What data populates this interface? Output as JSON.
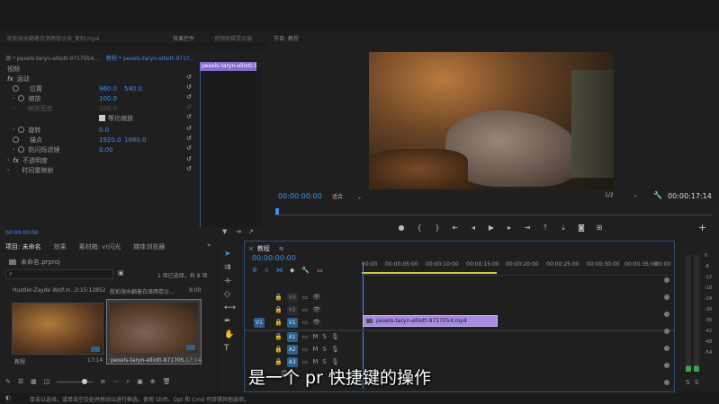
{
  "top_tabs": {
    "source_tab": "航拍海水翻着白浪两卷沙海_复制.mp4",
    "effect_controls_tab": "效果控件",
    "audio_mixer_tab": "音频剪辑混合器",
    "program_tab": "节目: 教程"
  },
  "effect_controls": {
    "source_label": "源 * pexels-taryn-elliott-9717054...",
    "sequence_label": "教程 * pexels-taryn-elliott-9717...",
    "clip_label": "pexels-taryn-elliott-971",
    "section_video": "视频",
    "motion": "运动",
    "position": "位置",
    "position_x": "960.0",
    "position_y": "540.0",
    "scale": "缩放",
    "scale_value": "100.0",
    "scale_width": "缩放宽度",
    "scale_width_value": "100.0",
    "uniform_scale": "等比缩放",
    "rotation": "旋转",
    "rotation_value": "0.0",
    "anchor": "锚点",
    "anchor_x": "1920.0",
    "anchor_y": "1080.0",
    "anti_flicker": "防闪烁滤镜",
    "anti_flicker_value": "0.00",
    "opacity": "不透明度",
    "time_remap": "时间重映射",
    "timecode": "00:00:00:00"
  },
  "program_monitor": {
    "timecode": "00:00:00:00",
    "fit": "适合",
    "resolution": "1/2",
    "duration": "00:00:17:14"
  },
  "project_panel": {
    "tabs": [
      "项目: 未命名",
      "效果",
      "素材箱: vr闪光",
      "媒体浏览器"
    ],
    "file": "未命名.prproj",
    "selection_info": "1 项已选择，共 8 项",
    "items": [
      {
        "name": "Hustler-Zayde Wolf.m...",
        "duration": "3:15:12852"
      },
      {
        "name": "航拍海水翻着白浪两卷沙...",
        "duration": "9:00"
      },
      {
        "name": "教程",
        "duration": "17:14"
      },
      {
        "name": "pexels-taryn-elliott-97170S...",
        "duration": "17:14"
      }
    ]
  },
  "timeline": {
    "tab": "教程",
    "timecode": "00:00:00:00",
    "ruler": [
      "00:00",
      "00:00:05:00",
      "00:00:10:00",
      "00:00:15:00",
      "00:00:20:00",
      "00:00:25:00",
      "00:00:30:00",
      "00:00:35:00",
      "00:00"
    ],
    "tracks": [
      {
        "label": "V3",
        "src": ""
      },
      {
        "label": "V2",
        "src": ""
      },
      {
        "label": "V1",
        "src": "V1"
      },
      {
        "label": "A1",
        "src": ""
      },
      {
        "label": "A2",
        "src": ""
      },
      {
        "label": "A3",
        "src": ""
      }
    ],
    "master": "混合",
    "clip_name": "pexels-taryn-elliott-9717054.mp4"
  },
  "subtitle": "是一个 pr 快捷键的操作",
  "status_bar": "单击以选择，或单击空白处并拖动以进行框选。使用 Shift、Opt 和 Cmd 可获得其他选项。",
  "meter": {
    "labels": [
      "0",
      "-6",
      "-12",
      "-18",
      "-24",
      "-30",
      "-36",
      "-42",
      "-48",
      "-54"
    ],
    "solo": [
      "S",
      "S"
    ]
  }
}
